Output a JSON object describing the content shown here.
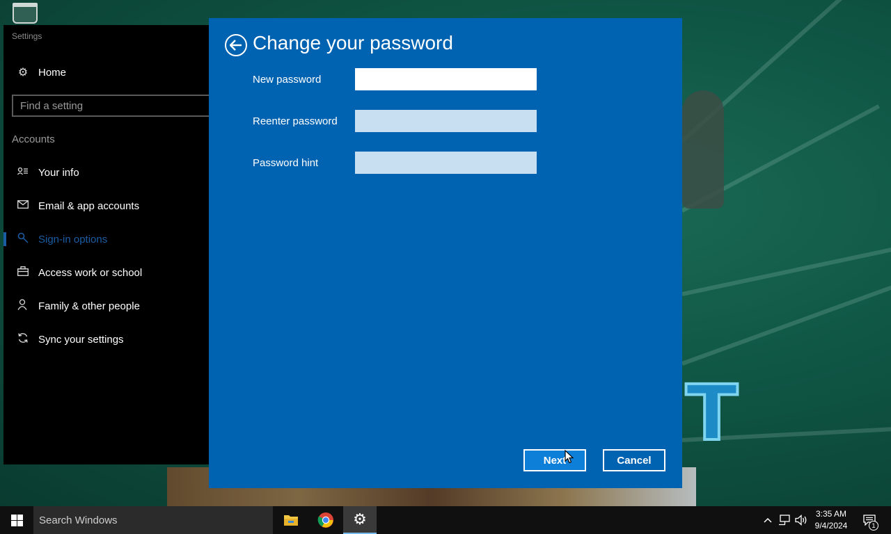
{
  "settings": {
    "window_title": "Settings",
    "home_label": "Home",
    "search_placeholder": "Find a setting",
    "section_header": "Accounts",
    "items": [
      {
        "label": "Your info",
        "icon": "person-card-icon"
      },
      {
        "label": "Email & app accounts",
        "icon": "mail-icon"
      },
      {
        "label": "Sign-in options",
        "icon": "key-icon",
        "active": true
      },
      {
        "label": "Access work or school",
        "icon": "briefcase-icon"
      },
      {
        "label": "Family & other people",
        "icon": "person-icon"
      },
      {
        "label": "Sync your settings",
        "icon": "sync-icon"
      }
    ]
  },
  "dialog": {
    "title": "Change your password",
    "fields": [
      {
        "label": "New password",
        "value": ""
      },
      {
        "label": "Reenter password",
        "value": ""
      },
      {
        "label": "Password hint",
        "value": ""
      }
    ],
    "next_label": "Next",
    "cancel_label": "Cancel"
  },
  "taskbar": {
    "search_label": "Search Windows",
    "apps": [
      "file-explorer-icon",
      "chrome-icon",
      "settings-gear-icon"
    ],
    "time": "3:35 AM",
    "date": "9/4/2024",
    "notification_count": "1"
  },
  "colors": {
    "dialog_bg": "#0063b1",
    "accent": "#1a5da4",
    "taskbar_bg": "#101010"
  }
}
